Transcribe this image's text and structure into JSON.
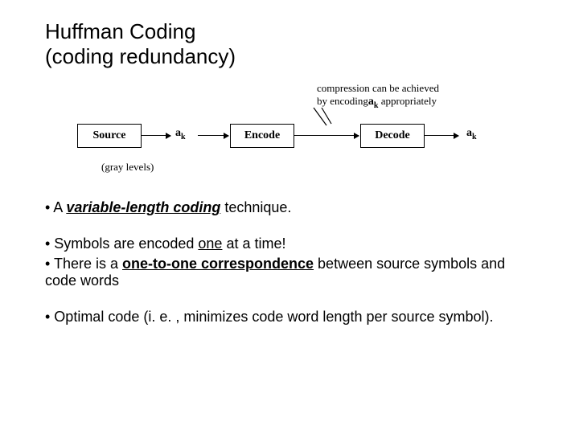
{
  "title": {
    "line1": "Huffman Coding",
    "line2": "(coding redundancy)"
  },
  "diagram": {
    "box_source": "Source",
    "box_encode": "Encode",
    "box_decode": "Decode",
    "symbol_a": "a",
    "symbol_k": "k",
    "annotation_l1": "compression can be achieved",
    "annotation_l2_a": "by encoding",
    "annotation_l2_b": "appropriately",
    "gray_levels": "(gray levels)"
  },
  "bullets": {
    "b1_a": "• A ",
    "b1_b": "variable-length coding",
    "b1_c": " technique.",
    "b2_a": "• Symbols are encoded ",
    "b2_b": "one",
    "b2_c": " at a time!",
    "b3_a": "• There is a ",
    "b3_b": "one-to-one correspondence",
    "b3_c": " between source symbols and code words",
    "b4": "• Optimal code (i. e. , minimizes code word length per source symbol)."
  }
}
